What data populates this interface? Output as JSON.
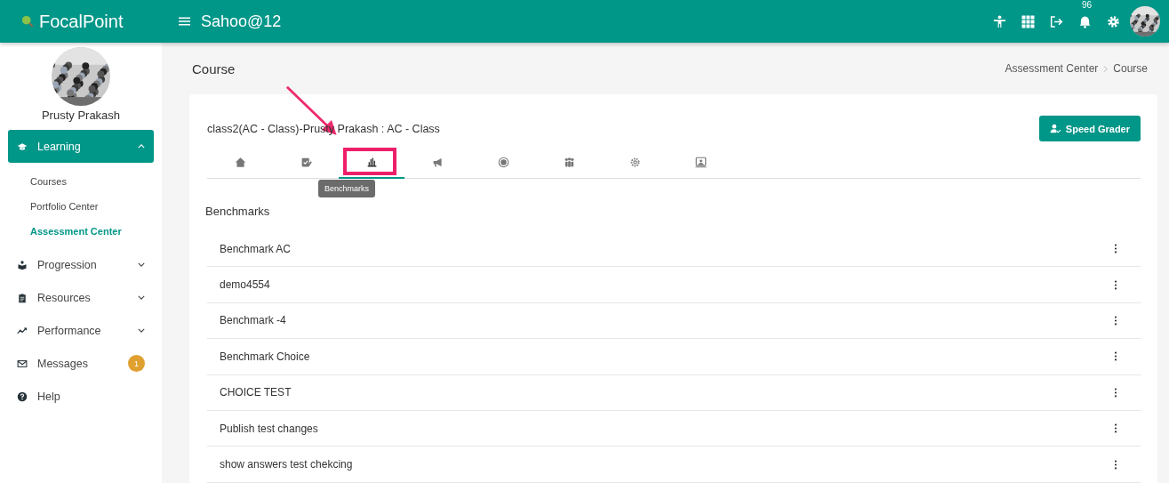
{
  "header": {
    "logo": "FocalPoint",
    "account": "Sahoo@12",
    "notification_count": "96"
  },
  "sidebar": {
    "user_name": "Prusty Prakash",
    "menu": [
      {
        "kind": "group",
        "label": "Learning",
        "expanded": true,
        "selected": true,
        "children": [
          {
            "label": "Courses",
            "selected": false
          },
          {
            "label": "Portfolio Center",
            "selected": false
          },
          {
            "label": "Assessment Center",
            "selected": true
          }
        ]
      },
      {
        "kind": "group",
        "label": "Progression",
        "expanded": false,
        "selected": false
      },
      {
        "kind": "group",
        "label": "Resources",
        "expanded": false,
        "selected": false
      },
      {
        "kind": "group",
        "label": "Performance",
        "expanded": false,
        "selected": false
      },
      {
        "kind": "link",
        "label": "Messages",
        "badge": "1",
        "selected": false
      },
      {
        "kind": "link",
        "label": "Help",
        "selected": false
      }
    ]
  },
  "page_title": "Course",
  "breadcrumb": [
    "Assessment Center",
    "Course"
  ],
  "card": {
    "title": "class2(AC - Class)-Prusty Prakash : AC - Class",
    "speed_grader_button": "Speed Grader",
    "tabs": [
      {
        "selected": false
      },
      {
        "selected": false
      },
      {
        "selected": true,
        "tooltip": "Benchmarks"
      },
      {
        "selected": false
      },
      {
        "selected": false
      },
      {
        "selected": false
      },
      {
        "selected": false
      },
      {
        "selected": false
      }
    ],
    "section_title": "Benchmarks",
    "items": [
      "Benchmark AC",
      "demo4554",
      "Benchmark -4",
      "Benchmark Choice",
      "CHOICE TEST",
      "Publish test changes",
      "show answers test chekcing"
    ]
  }
}
